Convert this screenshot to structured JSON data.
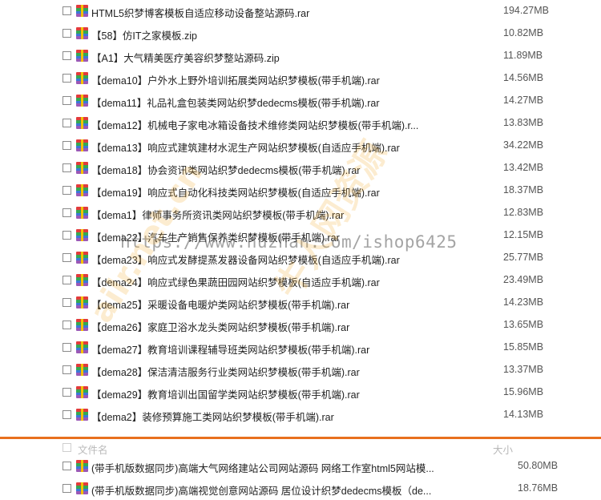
{
  "files": [
    {
      "name": "HTML5织梦博客模板自适应移动设备整站源码.rar",
      "size": "194.27MB"
    },
    {
      "name": "【58】仿IT之家模板.zip",
      "size": "10.82MB"
    },
    {
      "name": "【A1】大气精美医疗美容织梦整站源码.zip",
      "size": "11.89MB"
    },
    {
      "name": "【dema10】户外水上野外培训拓展类网站织梦模板(带手机端).rar",
      "size": "14.56MB"
    },
    {
      "name": "【dema11】礼品礼盒包装类网站织梦dedecms模板(带手机端).rar",
      "size": "14.27MB"
    },
    {
      "name": "【dema12】机械电子家电冰箱设备技术维修类网站织梦模板(带手机端).r...",
      "size": "13.83MB"
    },
    {
      "name": "【dema13】响应式建筑建材水泥生产网站织梦模板(自适应手机端).rar",
      "size": "34.22MB"
    },
    {
      "name": "【dema18】协会资讯类网站织梦dedecms模板(带手机端).rar",
      "size": "13.42MB"
    },
    {
      "name": "【dema19】响应式自动化科技类网站织梦模板(自适应手机端).rar",
      "size": "18.37MB"
    },
    {
      "name": "【dema1】律师事务所资讯类网站织梦模板(带手机端).rar",
      "size": "12.83MB"
    },
    {
      "name": "【dema22】汽车生产销售保养类织梦模板(带手机端).rar",
      "size": "12.15MB"
    },
    {
      "name": "【dema23】响应式发酵提蒸发器设备网站织梦模板(自适应手机端).rar",
      "size": "25.77MB"
    },
    {
      "name": "【dema24】响应式绿色果蔬田园网站织梦模板(自适应手机端).rar",
      "size": "23.49MB"
    },
    {
      "name": "【dema25】采暖设备电暖炉类网站织梦模板(带手机端).rar",
      "size": "14.23MB"
    },
    {
      "name": "【dema26】家庭卫浴水龙头类网站织梦模板(带手机端).rar",
      "size": "13.65MB"
    },
    {
      "name": "【dema27】教育培训课程辅导班类网站织梦模板(带手机端).rar",
      "size": "15.85MB"
    },
    {
      "name": "【dema28】保洁清洁服务行业类网站织梦模板(带手机端).rar",
      "size": "13.37MB"
    },
    {
      "name": "【dema29】教育培训出国留学类网站织梦模板(带手机端).rar",
      "size": "15.96MB"
    },
    {
      "name": "【dema2】装修预算施工类网站织梦模板(带手机端).rar",
      "size": "14.13MB"
    }
  ],
  "header": {
    "name_label": "文件名",
    "size_label": "大小"
  },
  "bottom_files": [
    {
      "name": "(带手机版数据同步)高端大气网络建站公司网站源码 网络工作室html5网站模...",
      "size": "50.80MB"
    },
    {
      "name": "(带手机版数据同步)高端视觉创意网站源码 居位设计织梦dedecms模板（de...",
      "size": "18.76MB"
    }
  ],
  "watermark": {
    "url": "https://www.huzhan.com/ishop6425",
    "text_a": "牛人网资源",
    "text_b": "ailr.net.cn"
  },
  "colors": {
    "divider": "#e8701e"
  }
}
